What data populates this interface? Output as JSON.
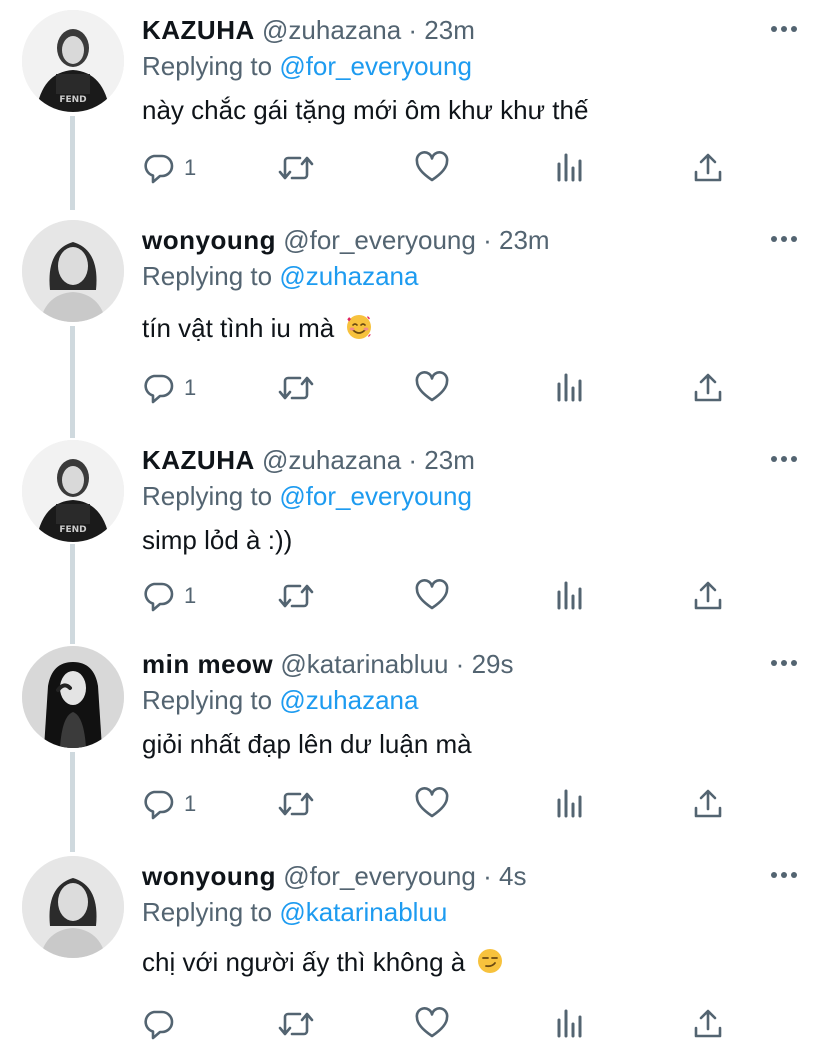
{
  "tweets": [
    {
      "name": "KAZUHA",
      "handle": "@zuhazana",
      "separator": "·",
      "time": "23m",
      "replying_prefix": "Replying to",
      "replying_to": "@for_everyoung",
      "text": "này chắc gái tặng mới ôm khư khư thế",
      "emoji": "",
      "reply_count": "1"
    },
    {
      "name": "wonyoung",
      "handle": "@for_everyoung",
      "separator": "·",
      "time": "23m",
      "replying_prefix": "Replying to",
      "replying_to": "@zuhazana",
      "text": "tín vật tình iu mà",
      "emoji": "smiling-face-with-hearts",
      "reply_count": "1"
    },
    {
      "name": "KAZUHA",
      "handle": "@zuhazana",
      "separator": "·",
      "time": "23m",
      "replying_prefix": "Replying to",
      "replying_to": "@for_everyoung",
      "text": "simp lỏd à :))",
      "emoji": "",
      "reply_count": "1"
    },
    {
      "name": "min meow",
      "handle": "@katarinabluu",
      "separator": "·",
      "time": "29s",
      "replying_prefix": "Replying to",
      "replying_to": "@zuhazana",
      "text": "giỏi nhất đạp lên dư luận mà",
      "emoji": "",
      "reply_count": "1"
    },
    {
      "name": "wonyoung",
      "handle": "@for_everyoung",
      "separator": "·",
      "time": "4s",
      "replying_prefix": "Replying to",
      "replying_to": "@katarinabluu",
      "text": "chị với người ấy thì không à",
      "emoji": "smirking-face",
      "reply_count": ""
    }
  ],
  "colors": {
    "link": "#1d9bf0",
    "secondary_text": "#536471",
    "primary_text": "#0f1419",
    "thread_line": "#cfd9de"
  }
}
